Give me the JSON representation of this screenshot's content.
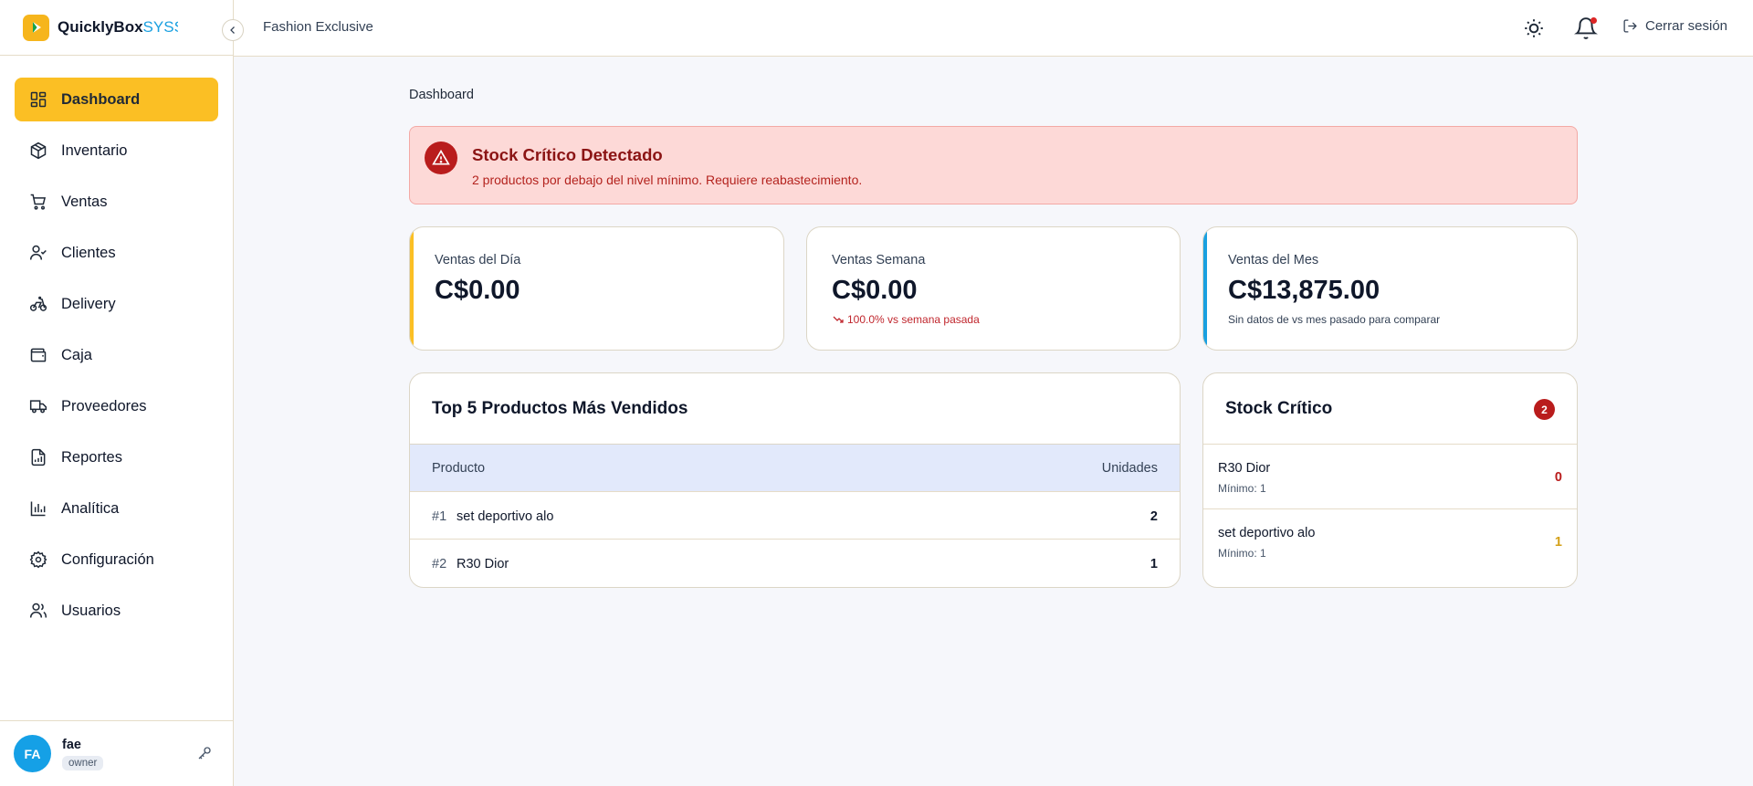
{
  "app": {
    "brand_main": "QuicklyBox",
    "brand_sub": "SYSS",
    "company": "Fashion Exclusive",
    "logout_label": "Cerrar sesión"
  },
  "sidebar": {
    "items": [
      {
        "label": "Dashboard",
        "icon": "dashboard-icon"
      },
      {
        "label": "Inventario",
        "icon": "package-icon"
      },
      {
        "label": "Ventas",
        "icon": "cart-icon"
      },
      {
        "label": "Clientes",
        "icon": "user-check-icon"
      },
      {
        "label": "Delivery",
        "icon": "bike-icon"
      },
      {
        "label": "Caja",
        "icon": "wallet-icon"
      },
      {
        "label": "Proveedores",
        "icon": "truck-icon"
      },
      {
        "label": "Reportes",
        "icon": "report-icon"
      },
      {
        "label": "Analítica",
        "icon": "bar-chart-icon"
      },
      {
        "label": "Configuración",
        "icon": "gear-icon"
      },
      {
        "label": "Usuarios",
        "icon": "users-icon"
      }
    ],
    "user": {
      "initials": "FA",
      "name": "fae",
      "role": "owner"
    }
  },
  "main": {
    "breadcrumb": "Dashboard",
    "alert": {
      "title": "Stock Crítico Detectado",
      "text": "2 productos por debajo del nivel mínimo. Requiere reabastecimiento."
    },
    "stats": [
      {
        "label": "Ventas del Día",
        "value": "C$0.00",
        "sub": "",
        "accent": "#fbbf24"
      },
      {
        "label": "Ventas Semana",
        "value": "C$0.00",
        "sub": "100.0% vs semana pasada",
        "accent": ""
      },
      {
        "label": "Ventas del Mes",
        "value": "C$13,875.00",
        "sub": "Sin datos de vs mes pasado para comparar",
        "accent": "#1aa0e0"
      }
    ],
    "top_products": {
      "title": "Top 5 Productos Más Vendidos",
      "col_product": "Producto",
      "col_units": "Unidades",
      "rows": [
        {
          "rank": "#1",
          "name": "set deportivo alo",
          "units": "2"
        },
        {
          "rank": "#2",
          "name": "R30 Dior",
          "units": "1"
        }
      ]
    },
    "critical_stock": {
      "title": "Stock Crítico",
      "count": "2",
      "items": [
        {
          "name": "R30 Dior",
          "min": "Mínimo: 1",
          "qty": "0",
          "color": "#b91c1c"
        },
        {
          "name": "set deportivo alo",
          "min": "Mínimo: 1",
          "qty": "1",
          "color": "#d4a017"
        }
      ]
    }
  },
  "colors": {
    "accent": "#fbbf24",
    "danger": "#b91c1c",
    "info": "#1aa0e0"
  }
}
